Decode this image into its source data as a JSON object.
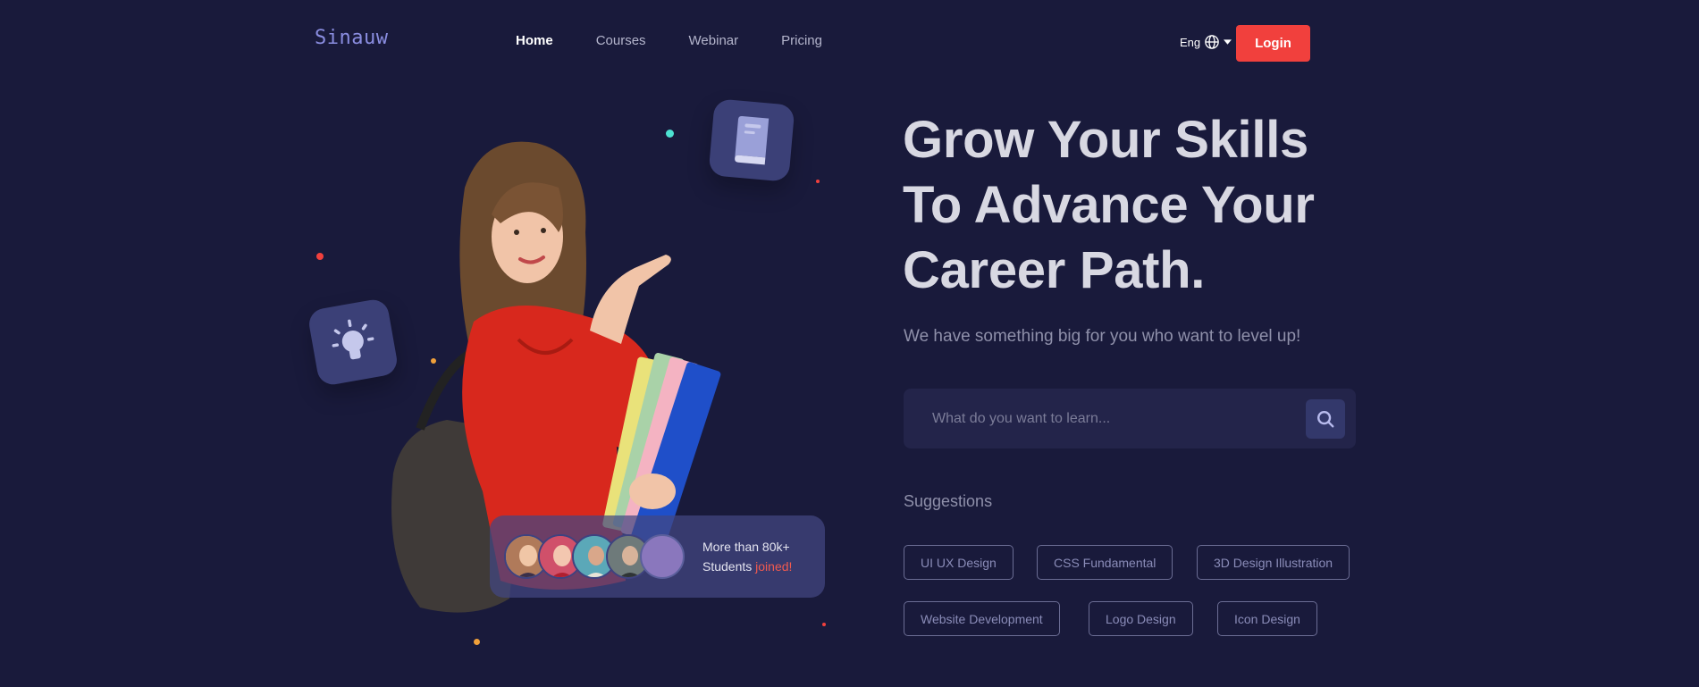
{
  "brand": {
    "logo": "Sinauw"
  },
  "nav": {
    "links": [
      "Home",
      "Courses",
      "Webinar",
      "Pricing"
    ],
    "active": "Home",
    "language": "Eng",
    "login_label": "Login"
  },
  "hero": {
    "headline": [
      "Grow Your Skills",
      "To Advance Your",
      "Career Path."
    ],
    "subheadline": "We have something big for you who want to level up!",
    "search": {
      "placeholder": "What do you want to learn..."
    },
    "students_card": {
      "line1": "More than 80k+",
      "line2_prefix": "Students",
      "line2_accent": "joined!"
    }
  },
  "suggestions": {
    "title": "Suggestions",
    "chips": [
      "UI UX Design",
      "CSS Fundamental",
      "3D Design Illustration",
      "Website Development",
      "Logo Design",
      "Icon Design"
    ]
  },
  "icons": {
    "search": "search-icon",
    "language": "globe-icon",
    "dropdown": "caret-down-icon",
    "tile_book": "book-icon",
    "tile_bulb": "lightbulb-icon"
  },
  "colors": {
    "background": "#191a3b",
    "accent": "#f1403d",
    "logo": "#8a8de0",
    "tile": "#3b4077"
  }
}
